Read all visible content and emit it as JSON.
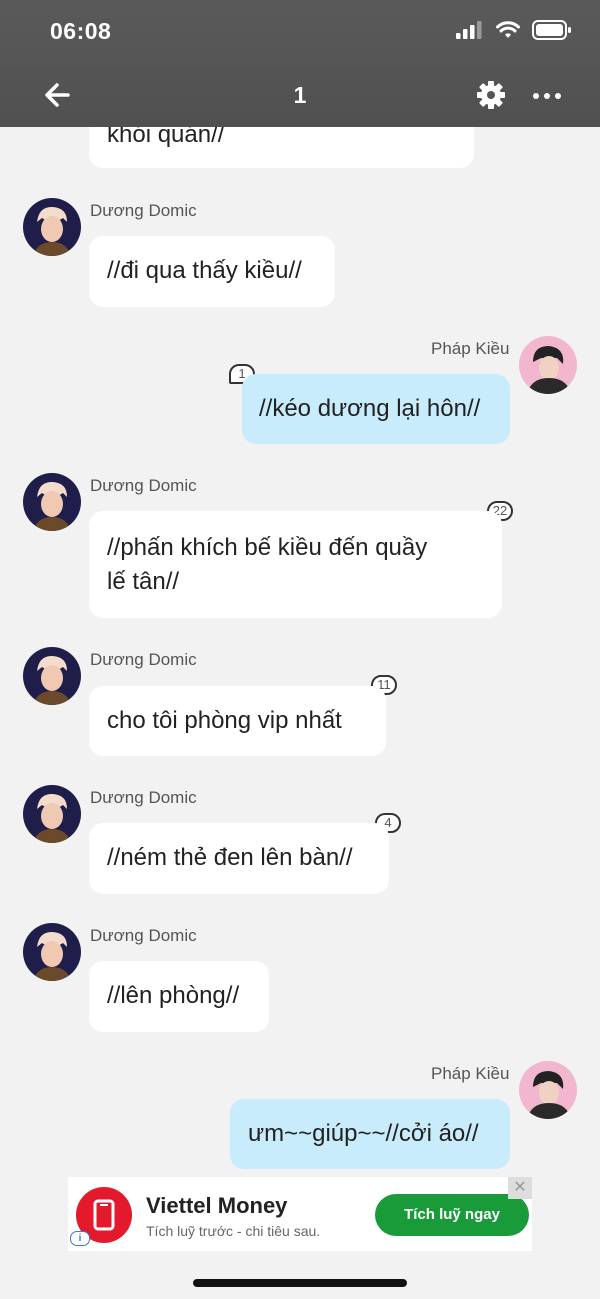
{
  "status_bar": {
    "time": "06:08"
  },
  "header": {
    "title": "1"
  },
  "messages": [
    {
      "text": "khói quán//"
    },
    {
      "sender": "Dương Domic",
      "text": "//đi qua thấy kiều//"
    },
    {
      "sender": "Pháp Kiều",
      "text": "//kéo dương lại hôn//",
      "badge": "1"
    },
    {
      "sender": "Dương Domic",
      "text_line1": "//phấn khích bế kiều đến quầy",
      "text_line2": "lế tân//",
      "badge": "22"
    },
    {
      "sender": "Dương Domic",
      "text": "cho tôi phòng vip nhất",
      "badge": "11"
    },
    {
      "sender": "Dương Domic",
      "text": "//ném thẻ đen lên bàn//",
      "badge": "4"
    },
    {
      "sender": "Dương Domic",
      "text": "//lên phòng//"
    },
    {
      "sender": "Pháp Kiều",
      "text": "ưm~~giúp~~//cởi áo//"
    }
  ],
  "ad": {
    "title": "Viettel Money",
    "subtitle": "Tích luỹ trước - chi tiêu sau.",
    "cta": "Tích luỹ ngay",
    "close": "✕",
    "info": "i",
    "brand_color": "#e21a2c",
    "cta_color": "#1a9b3a"
  },
  "colors": {
    "header_bg": "#555555",
    "incoming_bubble": "#ffffff",
    "outgoing_bubble": "#c8ecfb",
    "background": "#f2f2f2"
  },
  "icons": [
    "back-arrow-icon",
    "gear-icon",
    "more-icon",
    "signal-icon",
    "wifi-icon",
    "battery-icon"
  ]
}
